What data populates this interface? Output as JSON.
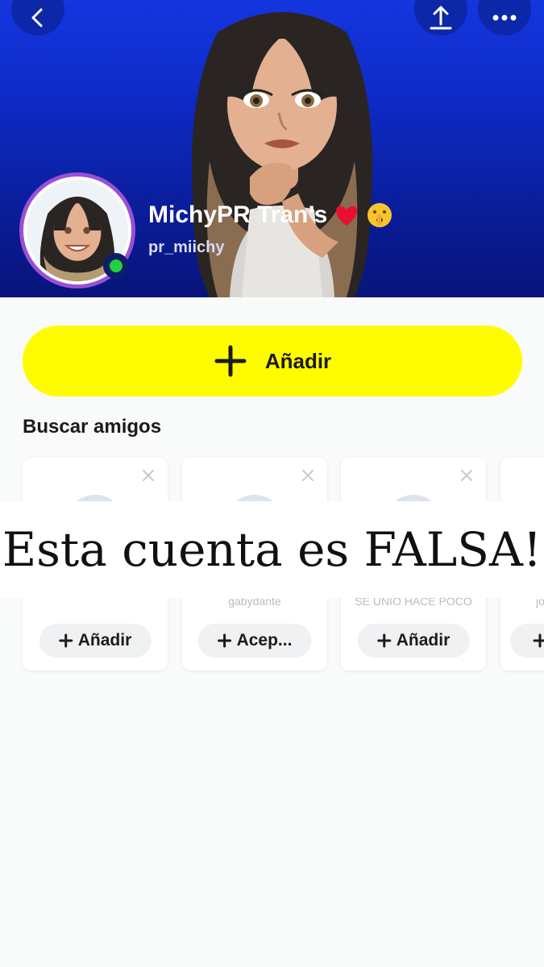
{
  "profile": {
    "display_name": "MichyPR Tran’s",
    "username": "pr_miichy",
    "name_emojis": [
      "red-heart-icon",
      "shushing-face-icon"
    ],
    "online": true
  },
  "actions": {
    "add_label": "Añadir"
  },
  "friends": {
    "title": "Buscar amigos",
    "cards": [
      {
        "subtitle": "",
        "button": "Añadir"
      },
      {
        "subtitle": "gabydante",
        "button": "Acep..."
      },
      {
        "subtitle": "SE UNIÓ HACE POCO",
        "button": "Añadir"
      },
      {
        "subtitle": "jo",
        "button": ""
      }
    ]
  },
  "overlay": {
    "text": "Esta cuenta es FALSA!"
  },
  "colors": {
    "hero_blue": "#1436e0",
    "add_yellow": "#fffc00",
    "online_green": "#22d13b",
    "avatar_ring": "#9b4fd6"
  }
}
